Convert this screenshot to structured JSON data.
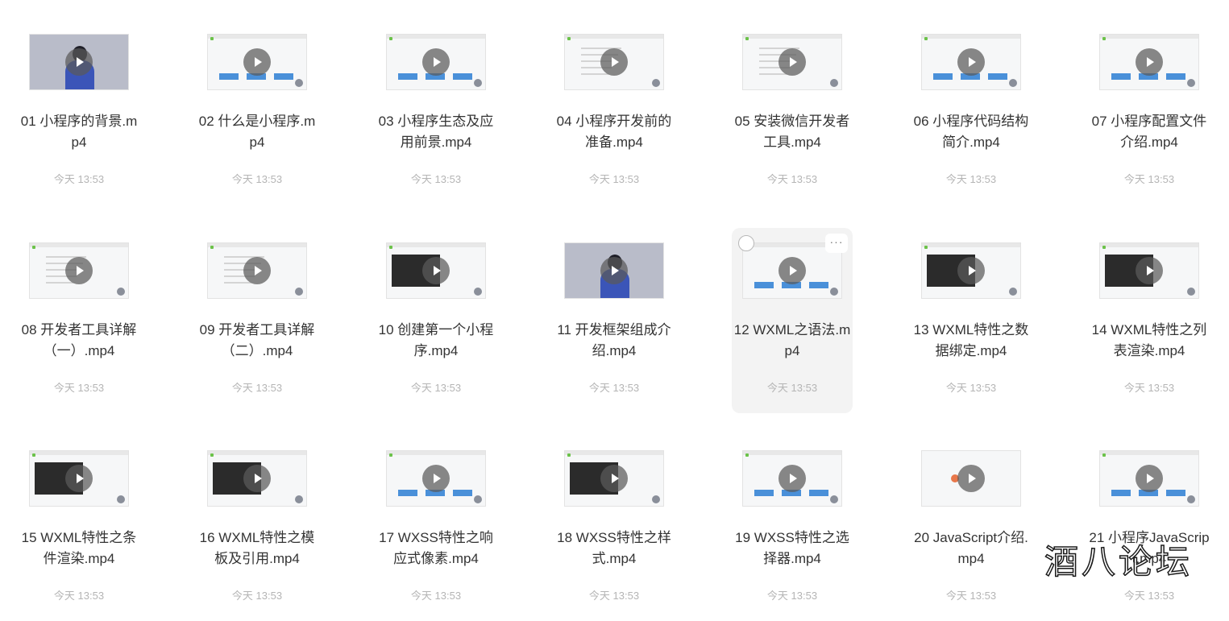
{
  "files": [
    {
      "name": "01 小程序的背景.mp4",
      "date": "今天 13:53",
      "thumb": "person"
    },
    {
      "name": "02 什么是小程序.mp4",
      "date": "今天 13:53",
      "thumb": "slide"
    },
    {
      "name": "03 小程序生态及应用前景.mp4",
      "date": "今天 13:53",
      "thumb": "slide"
    },
    {
      "name": "04 小程序开发前的准备.mp4",
      "date": "今天 13:53",
      "thumb": "browser"
    },
    {
      "name": "05 安装微信开发者工具.mp4",
      "date": "今天 13:53",
      "thumb": "browser"
    },
    {
      "name": "06 小程序代码结构简介.mp4",
      "date": "今天 13:53",
      "thumb": "slide"
    },
    {
      "name": "07 小程序配置文件介绍.mp4",
      "date": "今天 13:53",
      "thumb": "slide"
    },
    {
      "name": "08 开发者工具详解（一）.mp4",
      "date": "今天 13:53",
      "thumb": "browser"
    },
    {
      "name": "09 开发者工具详解（二）.mp4",
      "date": "今天 13:53",
      "thumb": "browser"
    },
    {
      "name": "10 创建第一个小程序.mp4",
      "date": "今天 13:53",
      "thumb": "code"
    },
    {
      "name": "11 开发框架组成介绍.mp4",
      "date": "今天 13:53",
      "thumb": "person"
    },
    {
      "name": "12 WXML之语法.mp4",
      "date": "今天 13:53",
      "thumb": "slide"
    },
    {
      "name": "13 WXML特性之数据绑定.mp4",
      "date": "今天 13:53",
      "thumb": "code"
    },
    {
      "name": "14 WXML特性之列表渲染.mp4",
      "date": "今天 13:53",
      "thumb": "code"
    },
    {
      "name": "15 WXML特性之条件渲染.mp4",
      "date": "今天 13:53",
      "thumb": "code"
    },
    {
      "name": "16 WXML特性之模板及引用.mp4",
      "date": "今天 13:53",
      "thumb": "code"
    },
    {
      "name": "17 WXSS特性之响应式像素.mp4",
      "date": "今天 13:53",
      "thumb": "slide"
    },
    {
      "name": "18 WXSS特性之样式.mp4",
      "date": "今天 13:53",
      "thumb": "code"
    },
    {
      "name": "19 WXSS特性之选择器.mp4",
      "date": "今天 13:53",
      "thumb": "slide"
    },
    {
      "name": "20 JavaScript介绍.mp4",
      "date": "今天 13:53",
      "thumb": "blank"
    },
    {
      "name": "21 小程序JavaScript.mp4",
      "date": "今天 13:53",
      "thumb": "slide"
    }
  ],
  "hover_tile": {
    "more_label": "···"
  },
  "watermark": "酒八论坛"
}
